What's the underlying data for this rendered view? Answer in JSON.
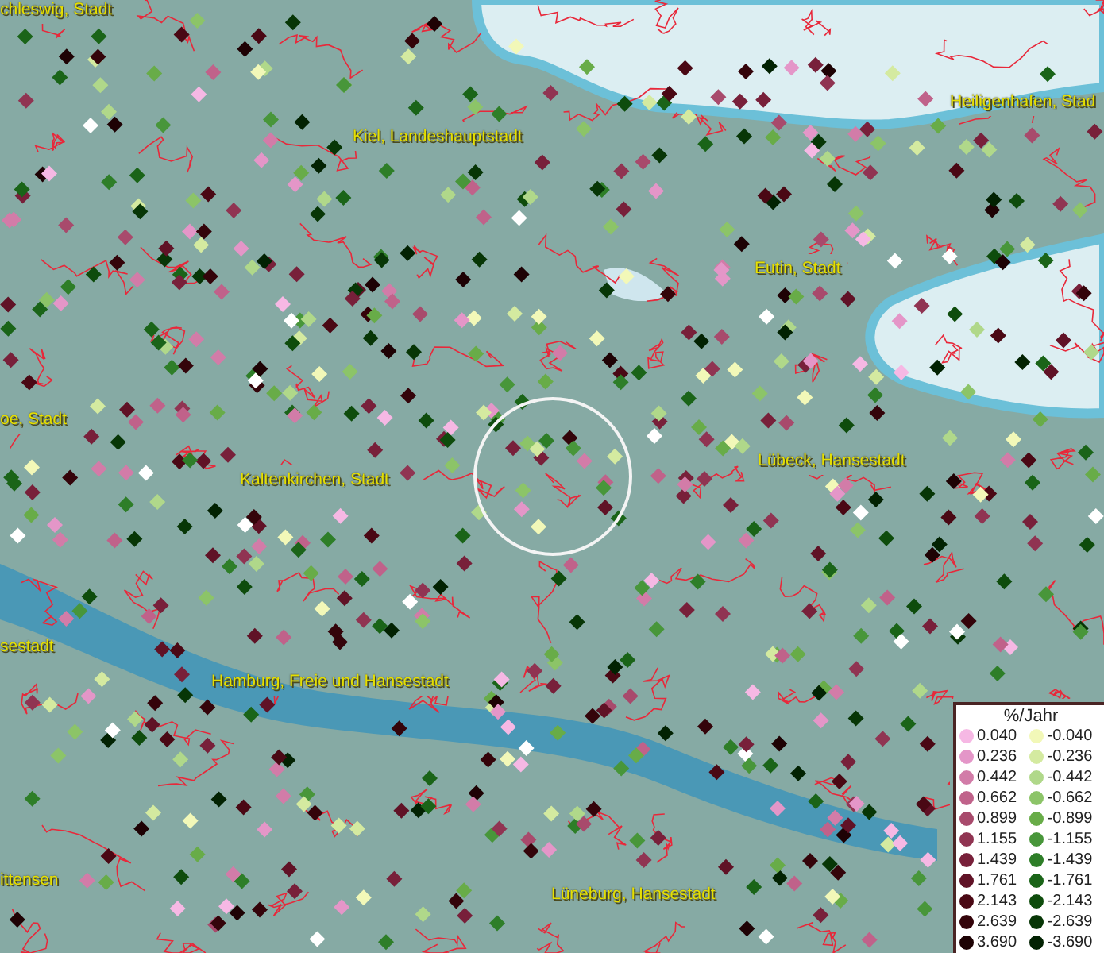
{
  "map": {
    "place_labels": [
      {
        "text": "chleswig, Stadt"
      },
      {
        "text": "Kiel, Landeshauptstadt"
      },
      {
        "text": "Heiligenhafen, Stad"
      },
      {
        "text": "Eutin, Stadt"
      },
      {
        "text": "oe, Stadt"
      },
      {
        "text": "Kaltenkirchen, Stadt"
      },
      {
        "text": "Lübeck, Hansestadt"
      },
      {
        "text": "sestadt"
      },
      {
        "text": "Hamburg, Freie und Hansestadt"
      },
      {
        "text": "ittensen"
      },
      {
        "text": "Lüneburg, Hansestadt"
      }
    ]
  },
  "legend": {
    "title": "%/Jahr",
    "rows": [
      {
        "left": {
          "label": "0.040",
          "color": "#f6b8e4"
        },
        "right": {
          "label": "-0.040",
          "color": "#f2f8b8"
        }
      },
      {
        "left": {
          "label": "0.236",
          "color": "#e496c8"
        },
        "right": {
          "label": "-0.236",
          "color": "#d4eaa0"
        }
      },
      {
        "left": {
          "label": "0.442",
          "color": "#d27ca8"
        },
        "right": {
          "label": "-0.442",
          "color": "#b0d88a"
        }
      },
      {
        "left": {
          "label": "0.662",
          "color": "#c0628a"
        },
        "right": {
          "label": "-0.662",
          "color": "#8cc468"
        }
      },
      {
        "left": {
          "label": "0.899",
          "color": "#a84a6c"
        },
        "right": {
          "label": "-0.899",
          "color": "#68ac48"
        }
      },
      {
        "left": {
          "label": "1.155",
          "color": "#903452"
        },
        "right": {
          "label": "-1.155",
          "color": "#48963a"
        }
      },
      {
        "left": {
          "label": "1.439",
          "color": "#78203a"
        },
        "right": {
          "label": "-1.439",
          "color": "#2e7e28"
        }
      },
      {
        "left": {
          "label": "1.761",
          "color": "#601226"
        },
        "right": {
          "label": "-1.761",
          "color": "#1a6418"
        }
      },
      {
        "left": {
          "label": "2.143",
          "color": "#4a0814"
        },
        "right": {
          "label": "-2.143",
          "color": "#0e4c0c"
        }
      },
      {
        "left": {
          "label": "2.639",
          "color": "#34040a"
        },
        "right": {
          "label": "-2.639",
          "color": "#073606"
        }
      },
      {
        "left": {
          "label": "3.690",
          "color": "#1e0204"
        },
        "right": {
          "label": "-3.690",
          "color": "#022202"
        }
      }
    ]
  }
}
